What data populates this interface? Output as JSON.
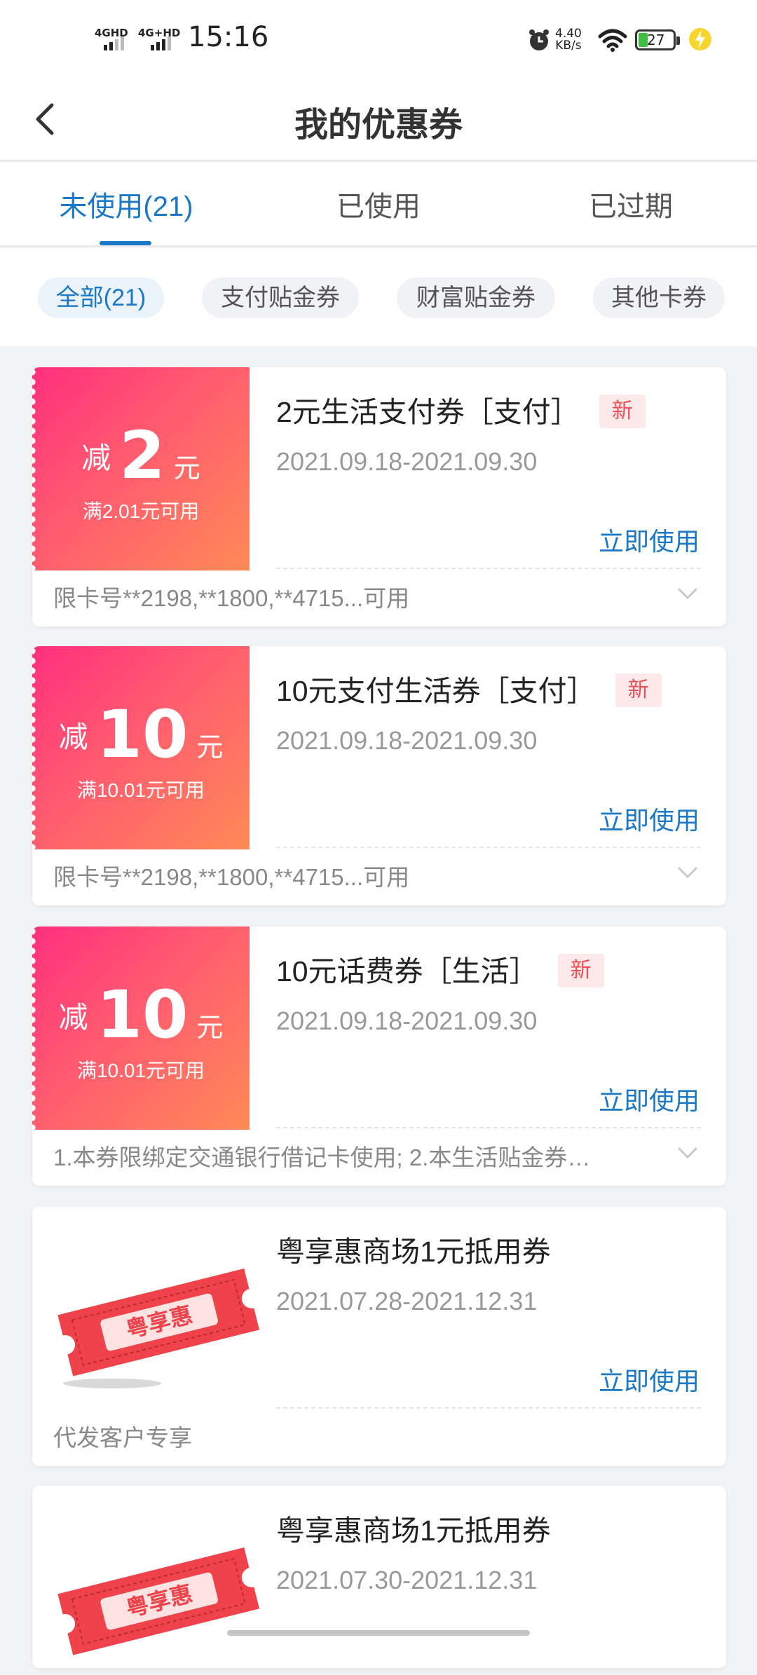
{
  "status_bar": {
    "signal1": "4GHD",
    "signal2": "4G+HD",
    "time": "15:16",
    "speed_value": "4.40",
    "speed_unit": "KB/s",
    "battery": "27"
  },
  "header": {
    "title": "我的优惠券"
  },
  "tabs": [
    {
      "label": "未使用(21)",
      "active": true
    },
    {
      "label": "已使用",
      "active": false
    },
    {
      "label": "已过期",
      "active": false
    }
  ],
  "filters": [
    {
      "label": "全部(21)",
      "active": true
    },
    {
      "label": "支付贴金券",
      "active": false
    },
    {
      "label": "财富贴金券",
      "active": false
    },
    {
      "label": "其他卡券",
      "active": false
    }
  ],
  "coupons": [
    {
      "type": "amount",
      "prefix": "减",
      "amount": "2",
      "unit": "元",
      "condition": "满2.01元可用",
      "title": "2元生活支付券［支付］",
      "badge": "新",
      "date": "2021.09.18-2021.09.30",
      "action": "立即使用",
      "note": "限卡号**2198,**1800,**4715...可用"
    },
    {
      "type": "amount",
      "prefix": "减",
      "amount": "10",
      "unit": "元",
      "condition": "满10.01元可用",
      "title": "10元支付生活券［支付］",
      "badge": "新",
      "date": "2021.09.18-2021.09.30",
      "action": "立即使用",
      "note": "限卡号**2198,**1800,**4715...可用"
    },
    {
      "type": "amount",
      "prefix": "减",
      "amount": "10",
      "unit": "元",
      "condition": "满10.01元可用",
      "title": "10元话费券［生活］",
      "badge": "新",
      "date": "2021.09.18-2021.09.30",
      "action": "立即使用",
      "note": "1.本券限绑定交通银行借记卡使用; 2.本生活贴金券…"
    },
    {
      "type": "stamp",
      "stamp_text": "粤享惠",
      "title": "粤享惠商场1元抵用券",
      "date": "2021.07.28-2021.12.31",
      "action": "立即使用",
      "note": "代发客户专享"
    },
    {
      "type": "stamp",
      "stamp_text": "粤享惠",
      "title": "粤享惠商场1元抵用券",
      "date": "2021.07.30-2021.12.31"
    }
  ],
  "colors": {
    "accent": "#1a78c6",
    "coupon_gradient_start": "#ff2f7e",
    "coupon_gradient_end": "#ff8a57",
    "badge_text": "#e94f57",
    "stamp_red": "#f0424a"
  }
}
